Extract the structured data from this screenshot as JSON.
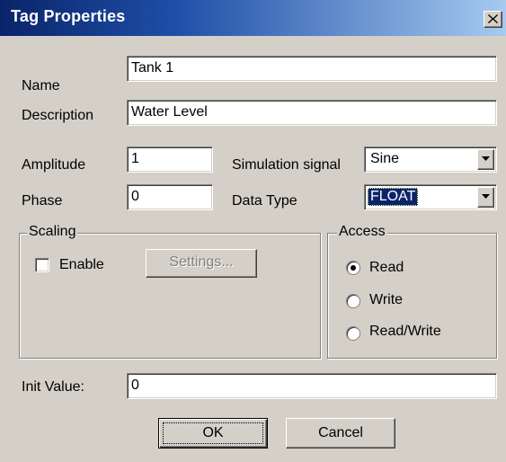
{
  "window": {
    "title": "Tag Properties",
    "close_icon": "close-icon"
  },
  "fields": {
    "name_label": "Name",
    "name_value": "Tank 1",
    "description_label": "Description",
    "description_value": "Water Level",
    "amplitude_label": "Amplitude",
    "amplitude_value": "1",
    "phase_label": "Phase",
    "phase_value": "0",
    "simulation_signal_label": "Simulation signal",
    "simulation_signal_value": "Sine",
    "data_type_label": "Data Type",
    "data_type_value": "FLOAT",
    "init_value_label": "Init Value:",
    "init_value_value": "0"
  },
  "scaling": {
    "title": "Scaling",
    "enable_label": "Enable",
    "enable_checked": false,
    "settings_label": "Settings..."
  },
  "access": {
    "title": "Access",
    "options": [
      {
        "label": "Read",
        "selected": true
      },
      {
        "label": "Write",
        "selected": false
      },
      {
        "label": "Read/Write",
        "selected": false
      }
    ]
  },
  "buttons": {
    "ok_label": "OK",
    "cancel_label": "Cancel"
  }
}
